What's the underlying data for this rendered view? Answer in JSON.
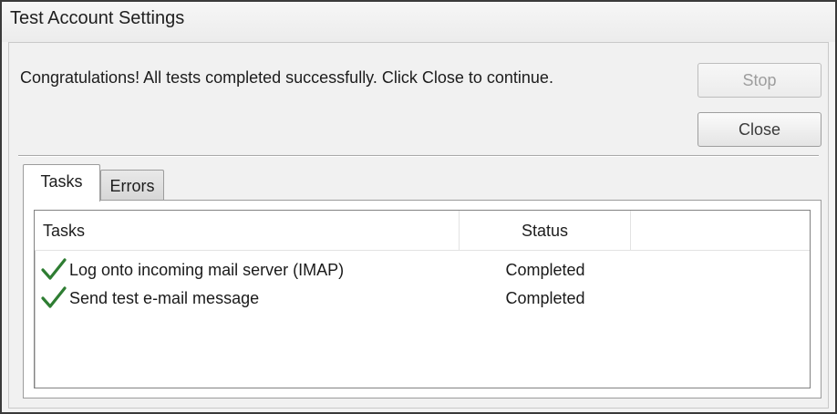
{
  "window": {
    "title": "Test Account Settings"
  },
  "message": "Congratulations! All tests completed successfully. Click Close to continue.",
  "buttons": {
    "stop": {
      "label": "Stop",
      "enabled": false
    },
    "close": {
      "label": "Close",
      "enabled": true
    }
  },
  "tabs": [
    {
      "label": "Tasks",
      "selected": true
    },
    {
      "label": "Errors",
      "selected": false
    }
  ],
  "table": {
    "columns": [
      "Tasks",
      "Status",
      ""
    ],
    "rows": [
      {
        "icon": "checkmark-icon",
        "task": "Log onto incoming mail server (IMAP)",
        "status": "Completed"
      },
      {
        "icon": "checkmark-icon",
        "task": "Send test e-mail message",
        "status": "Completed"
      }
    ]
  },
  "colors": {
    "check": "#2e7d32",
    "disabled_text": "#9d9d9d"
  }
}
